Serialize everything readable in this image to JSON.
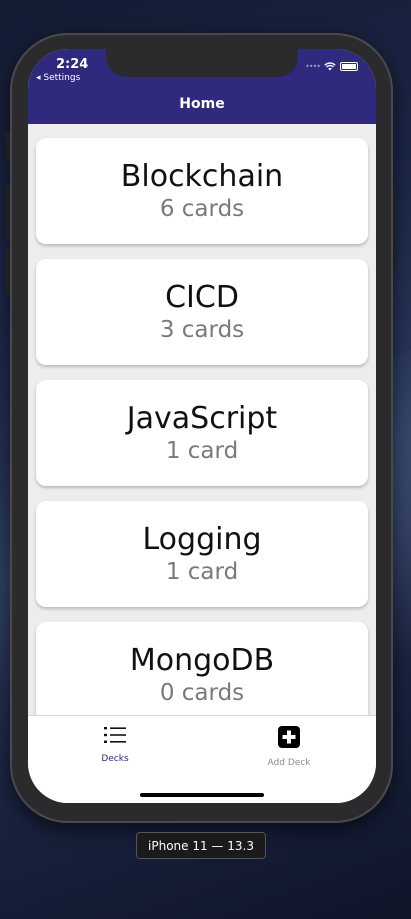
{
  "status_bar": {
    "time": "2:24",
    "back_label": "◂ Settings",
    "signal": "••••"
  },
  "header": {
    "title": "Home",
    "background": "#2f2a7e"
  },
  "decks": [
    {
      "title": "Blockchain",
      "count": "6 cards"
    },
    {
      "title": "CICD",
      "count": "3 cards"
    },
    {
      "title": "JavaScript",
      "count": "1 card"
    },
    {
      "title": "Logging",
      "count": "1 card"
    },
    {
      "title": "MongoDB",
      "count": "0 cards"
    }
  ],
  "tab_bar": {
    "tabs": [
      {
        "label": "Decks",
        "icon": "list-icon",
        "active": true,
        "color": "#2f2a7e"
      },
      {
        "label": "Add Deck",
        "icon": "plus-square-icon",
        "active": false,
        "color": "#8e8e93"
      }
    ]
  },
  "simulator": {
    "device_label": "iPhone 11 — 13.3"
  }
}
